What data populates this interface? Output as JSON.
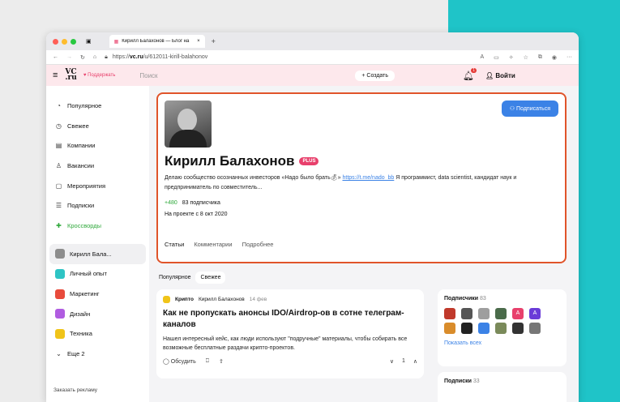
{
  "browser": {
    "tab_title": "Кирилл Балахонов — Блог на",
    "url_prefix": "https://",
    "url_domain": "vc.ru",
    "url_path": "/u/612011-kirill-balahonov"
  },
  "header": {
    "logo_top": "VC",
    "logo_bottom": ".ru",
    "support_label": "Поддержать",
    "search_placeholder": "Поиск",
    "create_label": "Создать",
    "notifications_count": "1",
    "login_label": "Войти"
  },
  "sidebar": {
    "items": [
      {
        "label": "Популярное",
        "icon": "fire-icon"
      },
      {
        "label": "Свежее",
        "icon": "clock-icon"
      },
      {
        "label": "Компании",
        "icon": "building-icon"
      },
      {
        "label": "Вакансии",
        "icon": "person-icon"
      },
      {
        "label": "Мероприятия",
        "icon": "calendar-icon"
      },
      {
        "label": "Подписки",
        "icon": "list-icon"
      },
      {
        "label": "Кроссворды",
        "icon": "crossword-icon"
      }
    ],
    "subs": [
      {
        "label": "Кирилл Бала...",
        "color": "#8d8d8d"
      },
      {
        "label": "Личный опыт",
        "color": "#2ec4c4"
      },
      {
        "label": "Маркетинг",
        "color": "#e84b3c"
      },
      {
        "label": "Дизайн",
        "color": "#b05ce0"
      },
      {
        "label": "Техника",
        "color": "#f0c419"
      }
    ],
    "more_label": "Еще 2",
    "ad_label": "Заказать рекламу"
  },
  "profile": {
    "name": "Кирилл Балахонов",
    "badge": "PLUS",
    "bio_before": "Делаю сообщество осознанных инвесторов «Надо было брать",
    "bio_link": "https://t.me/nado_bb",
    "bio_after": " Я программист, data scientist, кандидат наук и предприниматель по совместитель...",
    "karma": "+480",
    "followers": "83 подписчика",
    "since": "На проекте с 8 окт 2020",
    "subscribe_label": "Подписаться",
    "tabs": [
      "Статьи",
      "Комментарии",
      "Подробнее"
    ]
  },
  "feed": {
    "tabs": [
      "Популярное",
      "Свежее"
    ],
    "post": {
      "category": "Крипто",
      "author": "Кирилл Балахонов",
      "date": "14 фев",
      "title": "Как не пропускать анонсы IDO/Airdrop-ов в сотне телеграм-каналов",
      "text": "Нашел интересный кейс, как люди используют \"подручные\" материалы, чтобы собирать все возможные бесплатные раздачи крипто-проектов.",
      "discuss_label": "Обсудить",
      "votes": "1"
    }
  },
  "widgets": {
    "subscribers_title": "Подписчики",
    "subscribers_count": "83",
    "show_all": "Показать всех",
    "subscriptions_title": "Подписки",
    "subscriptions_count": "33",
    "avatars": [
      {
        "color": "#c0392b",
        "letter": ""
      },
      {
        "color": "#555555",
        "letter": ""
      },
      {
        "color": "#9e9e9e",
        "letter": ""
      },
      {
        "color": "#4a6b4a",
        "letter": ""
      },
      {
        "color": "#e8406c",
        "letter": "A"
      },
      {
        "color": "#6a3bd8",
        "letter": "A"
      },
      {
        "color": "#d98c2b",
        "letter": ""
      },
      {
        "color": "#222222",
        "letter": ""
      },
      {
        "color": "#3b82e6",
        "letter": ""
      },
      {
        "color": "#7a8a5a",
        "letter": ""
      },
      {
        "color": "#333333",
        "letter": ""
      },
      {
        "color": "#777777",
        "letter": ""
      }
    ]
  }
}
